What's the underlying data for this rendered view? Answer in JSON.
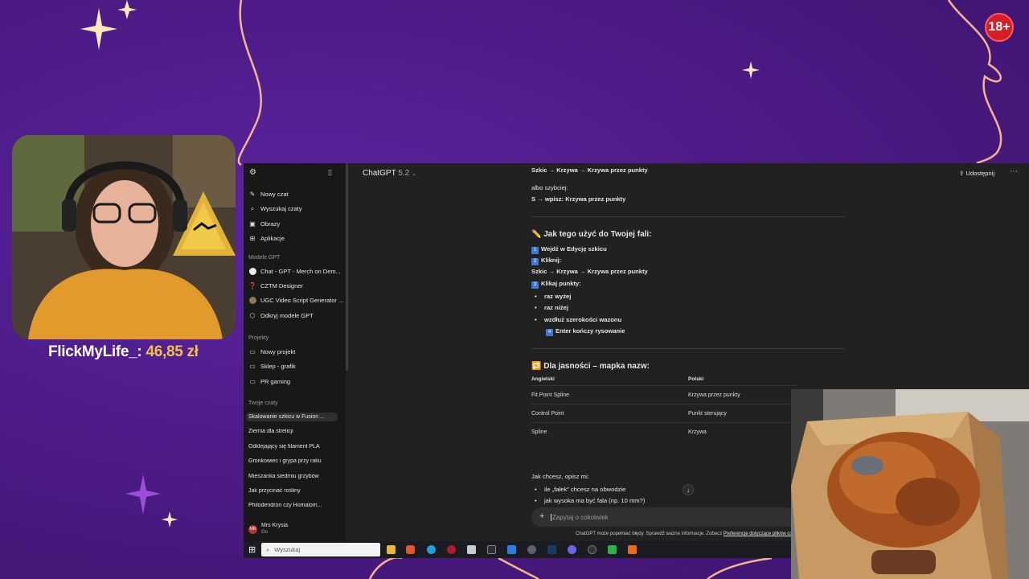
{
  "overlay": {
    "age_badge": "18+",
    "donation_user": "FlickMyLife_:",
    "donation_amount": "46,85 zł"
  },
  "app": {
    "title": "ChatGPT",
    "version": "5.2",
    "share_label": "Udostępnij"
  },
  "sidebar": {
    "primary": [
      {
        "label": "Nowy czat",
        "icon": "edit-icon"
      },
      {
        "label": "Wyszukaj czaty",
        "icon": "search-icon"
      },
      {
        "label": "Obrazy",
        "icon": "image-icon"
      },
      {
        "label": "Aplikacje",
        "icon": "grid-icon"
      }
    ],
    "gpt_heading": "Modele GPT",
    "gpts": [
      {
        "label": "Chat - GPT - Merch on Dem..."
      },
      {
        "label": "CZTM Designer"
      },
      {
        "label": "UGC Video Script Generator ..."
      },
      {
        "label": "Odkryj modele GPT"
      }
    ],
    "projects_heading": "Projekty",
    "projects": [
      {
        "label": "Nowy projekt"
      },
      {
        "label": "Sklep - grafik"
      },
      {
        "label": "PR gaming"
      }
    ],
    "chats_heading": "Twoje czaty",
    "chats": [
      "Skalowanie szkicu w Fusion ...",
      "Ziemia dla strelicji",
      "Odklejający się filament PLA",
      "Gronkowiec i grypa przy raku",
      "Mieszanka siedmiu grzybów",
      "Jak przycinać rośliny",
      "Philodendron czy Homalom..."
    ],
    "user": {
      "initials": "MR",
      "name": "Mrs Krysia",
      "plan": "Go"
    }
  },
  "conversation": {
    "line1": "Szkic → Krzywa → Krzywa przez punkty",
    "faster_intro": "albo szybciej:",
    "faster_cmd": "S → wpisz: Krzywa przez punkty",
    "section1_title": "Jak tego użyć do Twojej fali:",
    "step1_num": "1",
    "step1_pre": "Wejdź w ",
    "step1_bold": "Edycję szkicu",
    "step2_num": "2",
    "step2": "Kliknij:",
    "step2_path": "Szkic → Krzywa → Krzywa przez punkty",
    "step3_num": "3",
    "step3": "Klikaj punkty:",
    "points": [
      "raz wyżej",
      "raz niżej",
      "wzdłuż szerokości wazonu"
    ],
    "step4_num": "4",
    "step4": "Enter kończy rysowanie",
    "section2_title": "Dla jasności – mapka nazw:",
    "table": {
      "headers": [
        "Angielski",
        "Polski"
      ],
      "rows": [
        [
          "Fit Point Spline",
          "Krzywa przez punkty"
        ],
        [
          "Control Point",
          "Punkt sterujący"
        ],
        [
          "Spline",
          "Krzywa"
        ]
      ]
    },
    "closing_intro": "Jak chcesz, opisz mi:",
    "closing_points": [
      "ile „fałek” chcesz na obwodzie",
      "jak wysoka ma być fala (np. 10 mm?)"
    ]
  },
  "composer": {
    "placeholder": "Zapytaj o cokolwiek",
    "footer_text": "ChatGPT może popełniać błędy. Sprawdź ważne informacje. Zobacz ",
    "footer_link": "Preferencje dotyczące plików co"
  },
  "taskbar": {
    "search_placeholder": "Wyszukaj"
  }
}
